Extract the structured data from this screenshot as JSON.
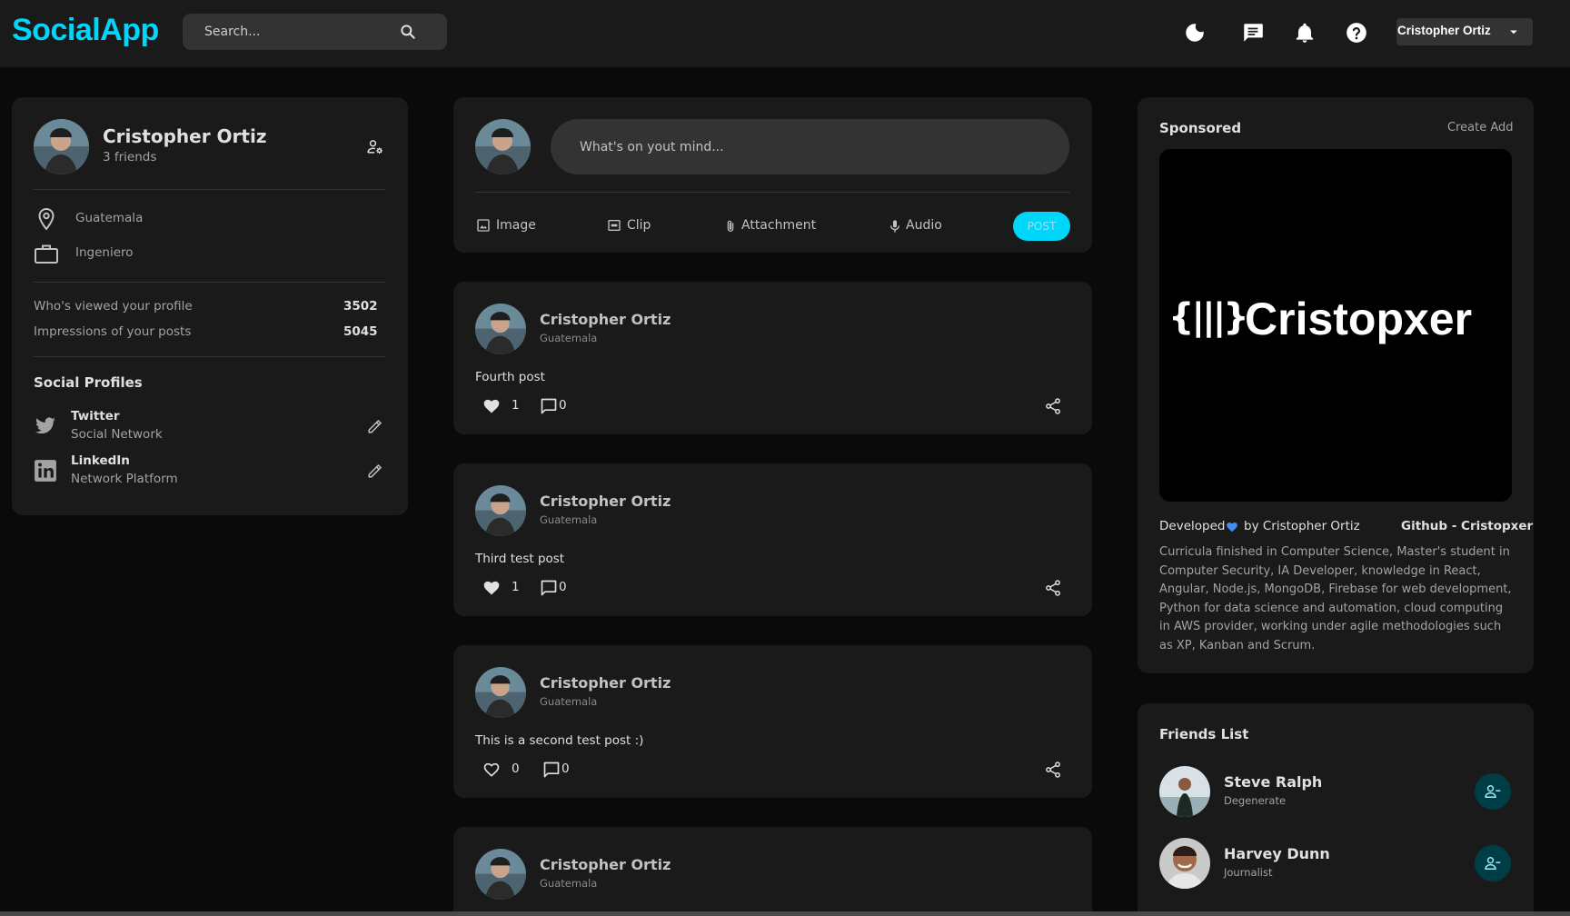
{
  "app": {
    "brand": "SocialApp",
    "search_placeholder": "Search...",
    "current_user": "Cristopher Ortiz",
    "accent_color": "#00d5fa",
    "icons": [
      "moon-icon",
      "message-icon",
      "bell-icon",
      "help-icon",
      "chevron-down-icon"
    ]
  },
  "profile": {
    "name": "Cristopher Ortiz",
    "friends": "3 friends",
    "location": "Guatemala",
    "occupation": "Ingeniero",
    "stats": [
      {
        "label": "Who's viewed your profile",
        "value": "3502"
      },
      {
        "label": "Impressions of your posts",
        "value": "5045"
      }
    ],
    "social_title": "Social Profiles",
    "socials": [
      {
        "name": "Twitter",
        "type": "Social Network"
      },
      {
        "name": "LinkedIn",
        "type": "Network Platform"
      }
    ]
  },
  "composer": {
    "placeholder": "What's on yout mind...",
    "actions": [
      "Image",
      "Clip",
      "Attachment",
      "Audio"
    ],
    "post_label": "POST"
  },
  "posts": [
    {
      "author": "Cristopher Ortiz",
      "location": "Guatemala",
      "text": "Fourth post",
      "likes": "1",
      "comments": "0",
      "liked": true
    },
    {
      "author": "Cristopher Ortiz",
      "location": "Guatemala",
      "text": "Third test post",
      "likes": "1",
      "comments": "0",
      "liked": true
    },
    {
      "author": "Cristopher Ortiz",
      "location": "Guatemala",
      "text": "This is a second test post :)",
      "likes": "0",
      "comments": "0",
      "liked": false
    },
    {
      "author": "Cristopher Ortiz",
      "location": "Guatemala"
    }
  ],
  "sponsored": {
    "title": "Sponsored",
    "create": "Create Add",
    "banner_text": "Cristopxer",
    "banner_logo": "{|||}",
    "developed_prefix": "Developed",
    "developed_suffix": "by Cristopher Ortiz",
    "github": "Github - Cristopxer",
    "description": "Curricula finished in Computer Science, Master's student in Computer Security, IA Developer, knowledge in React, Angular, Node.js, MongoDB, Firebase for web development, Python for data science and automation, cloud computing in AWS provider, working under agile methodologies such as XP, Kanban and Scrum."
  },
  "friends": {
    "title": "Friends List",
    "items": [
      {
        "name": "Steve Ralph",
        "occupation": "Degenerate"
      },
      {
        "name": "Harvey Dunn",
        "occupation": "Journalist"
      }
    ]
  }
}
